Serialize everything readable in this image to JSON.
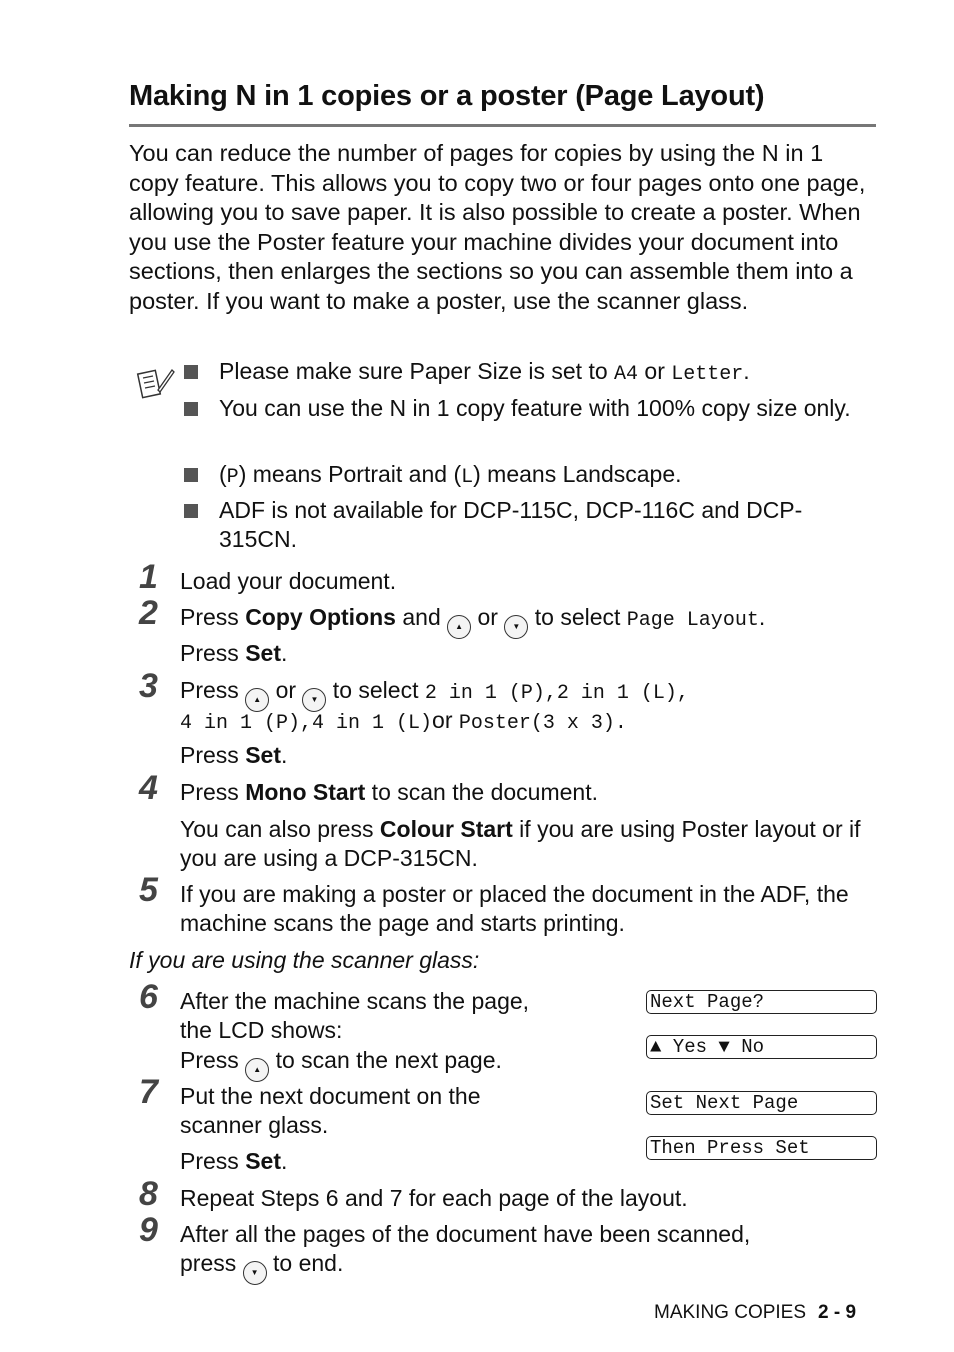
{
  "title": "Making N in 1 copies or a poster (Page Layout)",
  "intro": "You can reduce the number of pages for copies by using the N in 1 copy feature. This allows you to copy two or four pages onto one page, allowing you to save paper. It is also possible to create a poster. When you use the Poster feature your machine divides your document into sections, then enlarges the sections so you can assemble them into a poster. If you want to make a poster, use the scanner glass.",
  "notes": {
    "icon": "note-pad-pencil-icon",
    "n1_pre": "Please make sure Paper Size is set to ",
    "n1_a4": "A4",
    "n1_or": " or ",
    "n1_letter": "Letter",
    "n1_end": ".",
    "n2": "You can use the N in 1 copy feature with 100% copy size only.",
    "n3_open": "(",
    "n3_p": "P",
    "n3_mid": ") means Portrait and (",
    "n3_l": "L",
    "n3_end": ") means Landscape.",
    "n4": "ADF is not available for DCP-115C, DCP-116C and DCP-315CN."
  },
  "steps": {
    "s1": {
      "num": "1",
      "text": "Load your document."
    },
    "s2": {
      "num": "2",
      "press": "Press ",
      "key1": "Copy Options",
      "and": " and ",
      "or": " or ",
      "toselect": " to select ",
      "value": "Page Layout",
      "end": ".",
      "press2": "Press ",
      "set": "Set",
      "dot": "."
    },
    "s3": {
      "num": "3",
      "press": "Press ",
      "or": " or ",
      "toselect": " to select ",
      "opts1": "2 in 1 (P),2 in 1 (L),",
      "opts2": "4 in 1 (P),4 in 1 (L)",
      "or2": "or ",
      "opts3": "Poster(3 x 3).",
      "press2": "Press ",
      "set": "Set",
      "dot": "."
    },
    "s4": {
      "num": "4",
      "press": "Press ",
      "key": "Mono Start",
      "rest": " to scan the document.",
      "also": "You can also press ",
      "key2": "Colour Start",
      "rest2": " if you are using Poster layout or if you are using a DCP-315CN."
    },
    "s5": {
      "num": "5",
      "text": "If you are making a poster or placed the document in the ADF, the machine scans the page and starts printing."
    },
    "glass_heading": "If you are using the scanner glass:",
    "s6": {
      "num": "6",
      "line1": "After the machine scans the page,",
      "line2": "the LCD shows:",
      "press": "Press ",
      "rest": " to scan the next page."
    },
    "s7": {
      "num": "7",
      "line1": "Put the next document on the",
      "line2": "scanner glass.",
      "press": "Press ",
      "set": "Set",
      "dot": "."
    },
    "s8": {
      "num": "8",
      "text": "Repeat Steps 6 and 7 for each page of the layout."
    },
    "s9": {
      "num": "9",
      "line1": "After all the pages of the document have been scanned,",
      "press": "press ",
      "rest": " to end."
    }
  },
  "lcd": [
    "Next Page?",
    "▲ Yes ▼ No",
    "Set Next Page",
    "Then Press Set"
  ],
  "keys": {
    "up": "▲",
    "down": "▼"
  },
  "footer": {
    "section": "MAKING COPIES",
    "page": "2 - 9"
  }
}
